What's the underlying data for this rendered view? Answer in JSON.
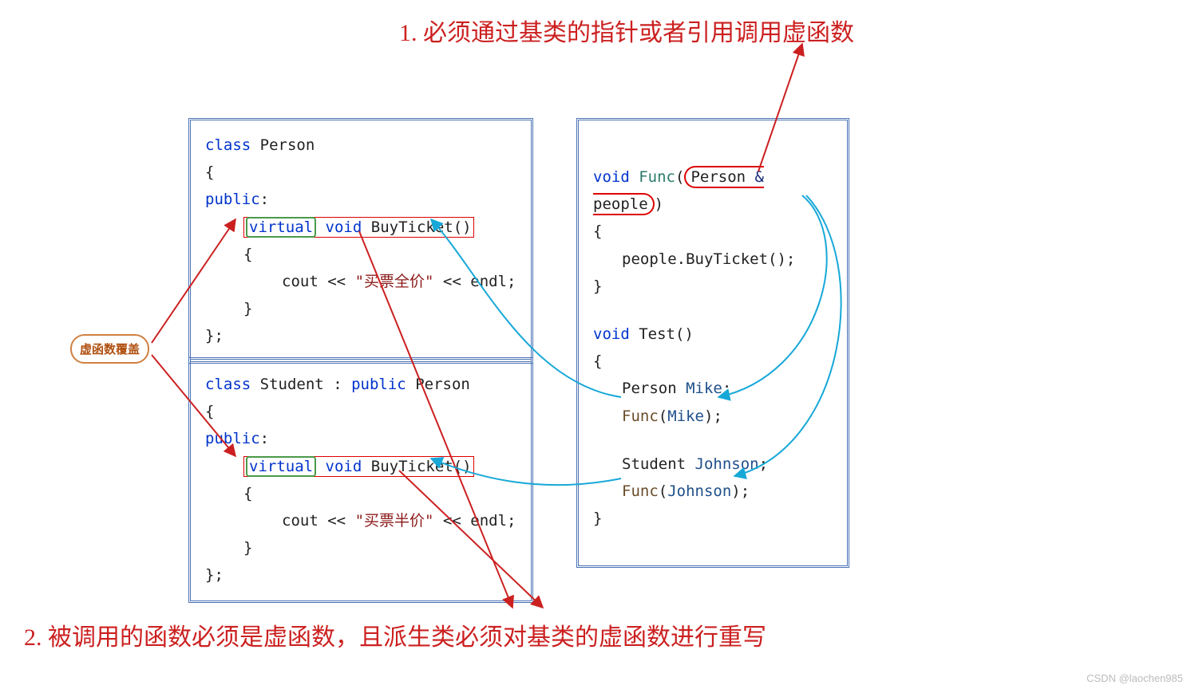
{
  "annotations": {
    "top": "1. 必须通过基类的指针或者引用调用虚函数",
    "bottom": "2. 被调用的函数必须是虚函数，且派生类必须对基类的虚函数进行重写",
    "chip": "虚函数覆盖"
  },
  "code": {
    "person": {
      "line1_kw": "class",
      "line1_name": "Person",
      "lbrace": "{",
      "pub": "public",
      "virtual": "virtual",
      "void": "void",
      "fn": "BuyTicket",
      "paren": "()",
      "body_cout": "cout",
      "body_op1": "<<",
      "body_str": "\"买票全价\"",
      "body_op2": "<<",
      "body_endl": "endl",
      "semicolon": ";",
      "rbrace": "}",
      "end": "};",
      "colon": ":"
    },
    "student": {
      "line1_kw": "class",
      "line1_name": "Student",
      "sep": ":",
      "pub_kw": "public",
      "base": "Person",
      "lbrace": "{",
      "pub": "public",
      "virtual": "virtual",
      "void": "void",
      "fn": "BuyTicket",
      "paren": "()",
      "body_cout": "cout",
      "body_op1": "<<",
      "body_str": "\"买票半价\"",
      "body_op2": "<<",
      "body_endl": "endl",
      "semicolon": ";",
      "rbrace": "}",
      "end": "};",
      "colon": ":"
    },
    "right": {
      "func_void": "void",
      "func_name": "Func",
      "person": "Person",
      "amp": "&",
      "param": "people",
      "call_obj": "people",
      "call_fn": ".BuyTicket();",
      "test_void": "void",
      "test_name": "Test",
      "paren": "()",
      "p_type": "Person",
      "p_var": "Mike",
      "call1_fn": "Func",
      "call1_arg": "Mike",
      "s_type": "Student",
      "s_var": "Johnson",
      "call2_fn": "Func",
      "call2_arg": "Johnson",
      "lbrace": "{",
      "rbrace": "}",
      "semicolon": ";",
      "lpar": "(",
      "rpar": ")",
      "comma": ","
    }
  },
  "watermark": "CSDN @laochen985"
}
